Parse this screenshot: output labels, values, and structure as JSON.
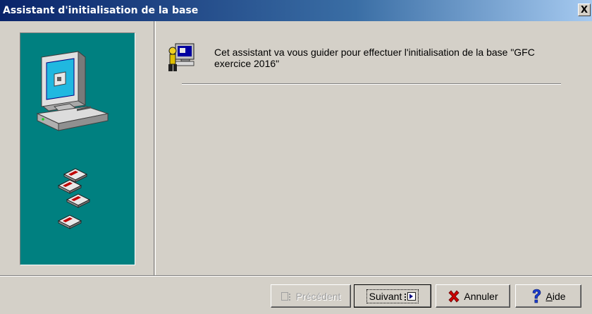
{
  "window": {
    "title": "Assistant d'initialisation de la base",
    "close_glyph": "X"
  },
  "main": {
    "intro_text": "Cet assistant va vous guider pour effectuer l'initialisation de la base \"GFC exercice 2016\""
  },
  "buttons": {
    "previous_label": "Précédent",
    "next_label": "Suivant",
    "cancel_label": "Annuler",
    "help_label_prefix": "",
    "help_label_mnemonic": "A",
    "help_label_rest": "ide"
  },
  "icons": {
    "computer": "computer-icon",
    "floppy": "floppy-disk-icon",
    "wizard": "wizard-assistant-icon",
    "previous": "previous-arrow-icon",
    "next": "next-arrow-icon",
    "cancel": "cancel-x-icon",
    "help": "help-question-icon"
  },
  "colors": {
    "title_bar_start": "#0a246a",
    "title_bar_end": "#a6caf0",
    "panel_teal": "#008080",
    "window_face": "#d4d0c8",
    "cancel_red": "#cc0000",
    "help_blue": "#1a3ccf"
  }
}
